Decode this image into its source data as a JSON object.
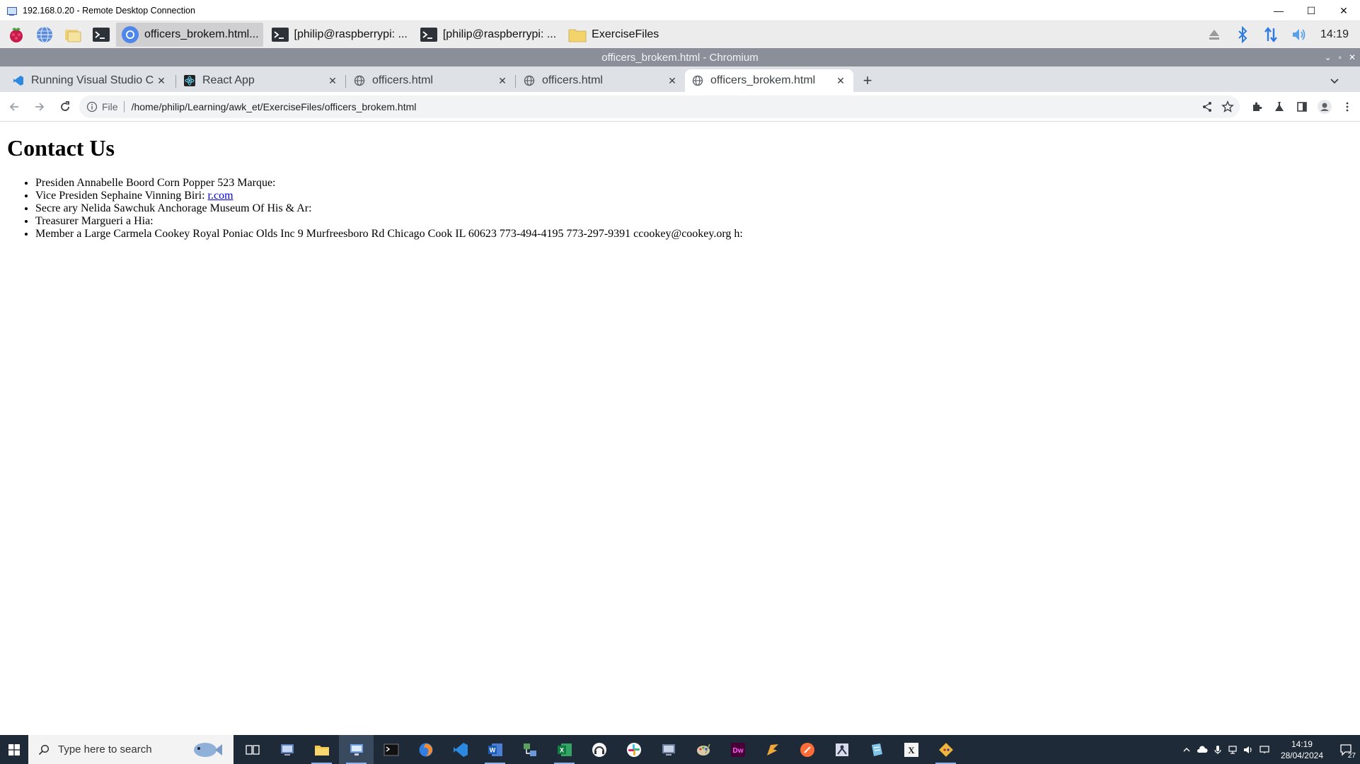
{
  "rdp": {
    "title": "192.168.0.20 - Remote Desktop Connection",
    "controls": [
      "—",
      "☐",
      "✕"
    ]
  },
  "pi_panel": {
    "tasks": [
      {
        "label": "officers_brokem.html...",
        "icon": "chromium-icon",
        "active": true
      },
      {
        "label": "[philip@raspberrypi: ...",
        "icon": "terminal-icon",
        "active": false
      },
      {
        "label": "[philip@raspberrypi: ...",
        "icon": "terminal-icon",
        "active": false
      },
      {
        "label": "ExerciseFiles",
        "icon": "folder-icon",
        "active": false
      }
    ],
    "clock": "14:19"
  },
  "chromium": {
    "window_title": "officers_brokem.html - Chromium",
    "tabs": [
      {
        "label": "Running Visual Studio C",
        "icon": "vscode-icon",
        "active": false
      },
      {
        "label": "React App",
        "icon": "react-icon",
        "active": false
      },
      {
        "label": "officers.html",
        "icon": "globe-icon",
        "active": false
      },
      {
        "label": "officers.html",
        "icon": "globe-icon",
        "active": false
      },
      {
        "label": "officers_brokem.html",
        "icon": "globe-icon",
        "active": true
      }
    ],
    "close_glyph": "✕",
    "newtab_glyph": "+",
    "omnibox": {
      "scheme": "File",
      "url": "/home/philip/Learning/awk_et/ExerciseFiles/officers_brokem.html"
    }
  },
  "page": {
    "heading": "Contact Us",
    "items": [
      {
        "text": "Presiden Annabelle Boord Corn Popper 523 Marque:",
        "link": ""
      },
      {
        "text": "Vice Presiden Sephaine Vinning Biri: ",
        "link": "r.com"
      },
      {
        "text": "Secre ary Nelida Sawchuk Anchorage Museum Of His & Ar:",
        "link": ""
      },
      {
        "text": "Treasurer Margueri a Hia:",
        "link": ""
      },
      {
        "text": "Member a Large Carmela Cookey Royal Poniac Olds Inc 9 Murfreesboro Rd Chicago Cook IL 60623 773-494-4195 773-297-9391 ccookey@cookey.org h:",
        "link": ""
      }
    ]
  },
  "windows_taskbar": {
    "search_placeholder": "Type here to search",
    "clock_time": "14:19",
    "clock_date": "28/04/2024",
    "notification_count": "27"
  },
  "colors": {
    "chromium_titlebar": "#8a8f99",
    "tabstrip": "#dee1e6",
    "link": "#0000ee",
    "win_taskbar": "#1f2a38"
  }
}
